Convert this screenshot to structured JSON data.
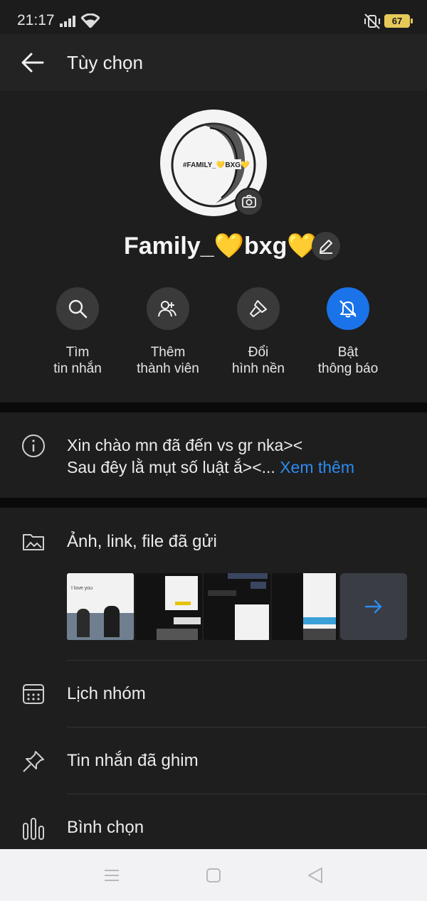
{
  "status": {
    "time": "21:17",
    "battery": "67"
  },
  "appbar": {
    "title": "Tùy chọn"
  },
  "group": {
    "avatar_text": "#FAMILY_💛BXG💛",
    "name": "Family_💛bxg💛"
  },
  "actions": [
    {
      "line1": "Tìm",
      "line2": "tin nhắn"
    },
    {
      "line1": "Thêm",
      "line2": "thành viên"
    },
    {
      "line1": "Đổi",
      "line2": "hình nền"
    },
    {
      "line1": "Bật",
      "line2": "thông báo"
    }
  ],
  "description": {
    "line1": "Xin chào mn đã đến vs gr nka><",
    "line2": "Sau đêy lằ mụt số luật ắ><...",
    "more": "Xem thêm"
  },
  "media": {
    "label": "Ảnh, link, file đã gửi",
    "thumb_caption": "I love you"
  },
  "menu": {
    "calendar": "Lịch nhóm",
    "pinned": "Tin nhắn đã ghim",
    "poll": "Bình chọn"
  },
  "colors": {
    "accent": "#1a73e8",
    "link": "#2d8cf0",
    "battery": "#e7c95a"
  }
}
